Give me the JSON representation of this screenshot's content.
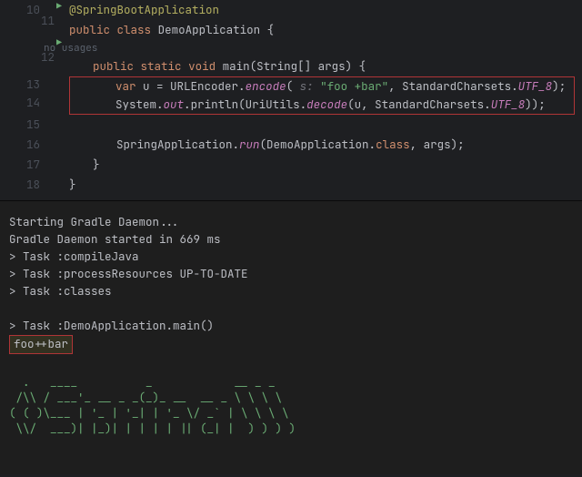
{
  "editor": {
    "lines": {
      "l10": {
        "num": "10",
        "annotation": "@SpringBootApplication"
      },
      "l11": {
        "num": "11",
        "kw_public": "public",
        "kw_class": "class",
        "class_name": "DemoApplication",
        "brace": "{"
      },
      "inlay_usages": "no usages",
      "l12": {
        "num": "12",
        "kw_public": "public",
        "kw_static": "static",
        "kw_void": "void",
        "method": "main",
        "params": "(String[] args) {"
      },
      "l13": {
        "num": "13",
        "kw_var": "var",
        "var_name": " u = ",
        "cls_enc": "URLEncoder",
        "dot1": ".",
        "mtd_enc": "encode",
        "open": "(",
        "param_hint": " s: ",
        "str": "\"foo +bar\"",
        "comma": ", ",
        "cls_charset": "StandardCharsets",
        "dot2": ".",
        "fld_utf8": "UTF_8",
        "close": ");"
      },
      "l14": {
        "num": "14",
        "cls_sys": "System",
        "dot1": ".",
        "fld_out": "out",
        "dot2": ".",
        "mtd_println": "println",
        "open": "(",
        "cls_uri": "UriUtils",
        "dot3": ".",
        "mtd_decode": "decode",
        "open2": "(u, ",
        "cls_charset": "StandardCharsets",
        "dot4": ".",
        "fld_utf8": "UTF_8",
        "close": "));"
      },
      "l15": {
        "num": "15"
      },
      "l16": {
        "num": "16",
        "cls_app": "SpringApplication",
        "dot": ".",
        "mtd_run": "run",
        "open": "(DemoApplication.",
        "kw_class": "class",
        "rest": ", args);"
      },
      "l17": {
        "num": "17",
        "brace": "}"
      },
      "l18": {
        "num": "18",
        "brace": "}"
      }
    }
  },
  "console": {
    "l1": "Starting Gradle Daemon...",
    "l2": "Gradle Daemon started in 669 ms",
    "l3": "> Task :compileJava",
    "l4": "> Task :processResources UP-TO-DATE",
    "l5": "> Task :classes",
    "l6": "",
    "l7": "> Task :DemoApplication.main()",
    "output": "foo++bar",
    "ascii": "  .   ____          _            __ _ _\n /\\\\ / ___'_ __ _ _(_)_ __  __ _ \\ \\ \\ \\\n( ( )\\___ | '_ | '_| | '_ \\/ _` | \\ \\ \\ \\\n \\\\/  ___)| |_)| | | | | || (_| |  ) ) ) )"
  }
}
